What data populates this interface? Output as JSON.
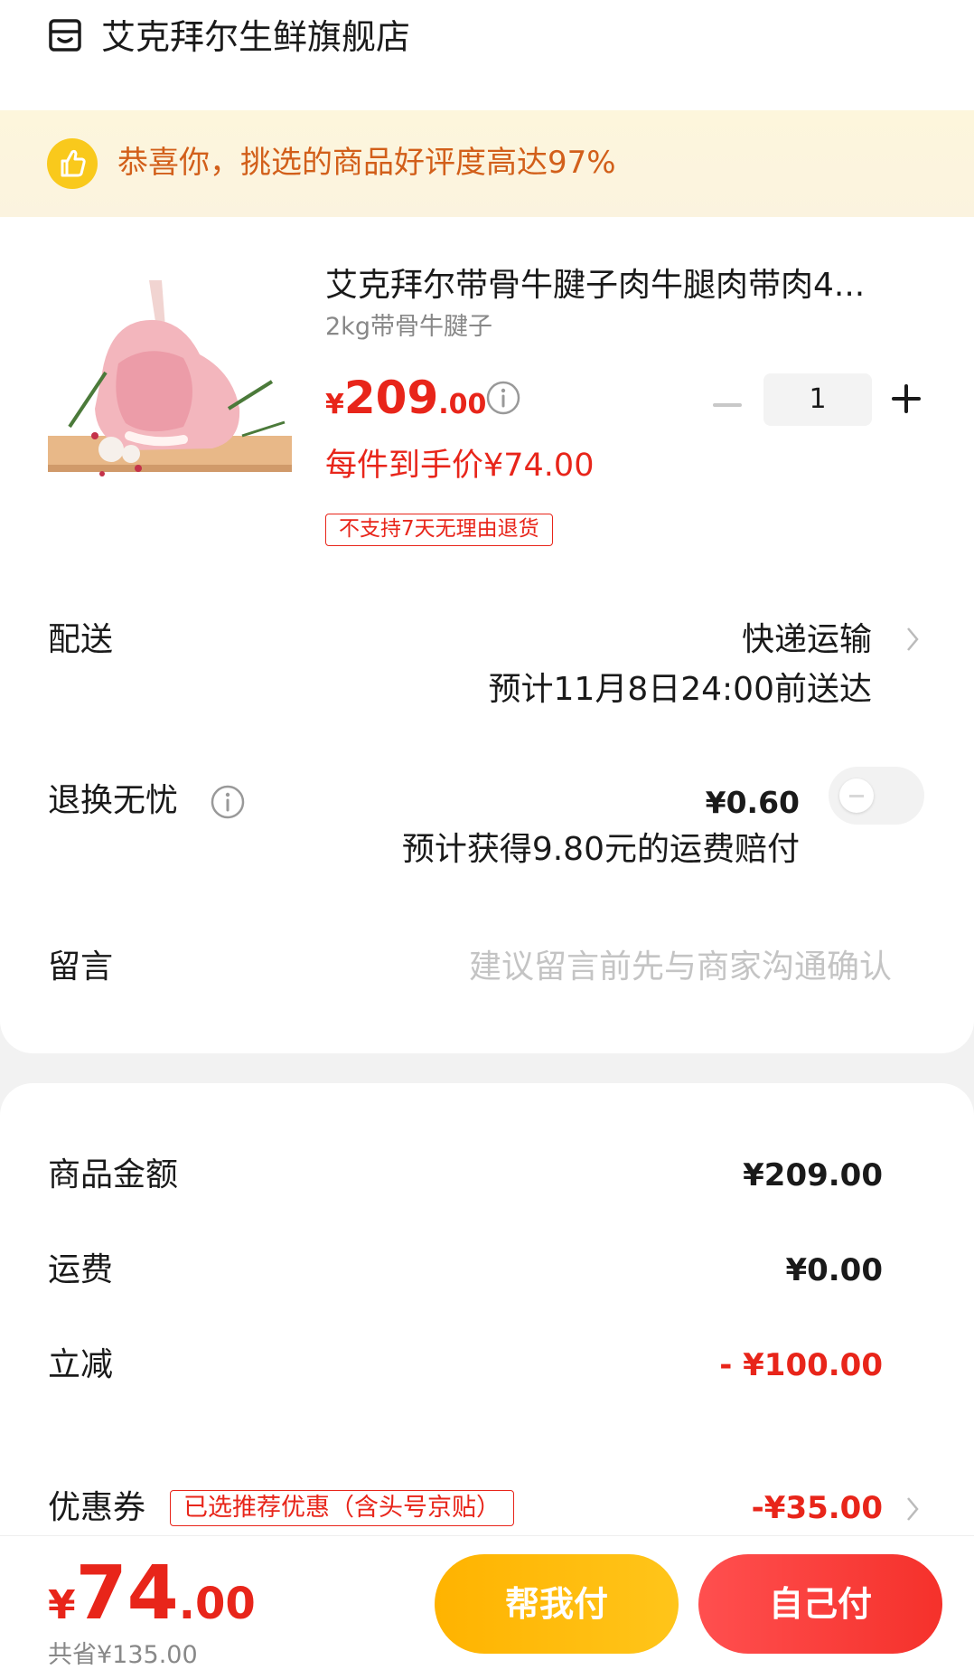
{
  "store": {
    "name": "艾克拜尔生鲜旗舰店",
    "icon": "store-icon"
  },
  "banner": {
    "text": "恭喜你，挑选的商品好评度高达97%",
    "icon": "thumbs-up-icon"
  },
  "product": {
    "title": "艾克拜尔带骨牛腱子肉牛腿肉带肉4...",
    "spec": "2kg带骨牛腱子",
    "price_symbol": "¥",
    "price_int": "209",
    "price_dec": ".00",
    "quantity": "1",
    "hand_price": "每件到手价¥74.00",
    "return_tag": "不支持7天无理由退货"
  },
  "delivery": {
    "label": "配送",
    "method": "快递运输",
    "eta": "预计11月8日24:00前送达"
  },
  "return_insurance": {
    "label": "退换无忧",
    "price": "¥0.60",
    "note": "预计获得9.80元的运费赔付",
    "enabled": false
  },
  "message": {
    "label": "留言",
    "placeholder": "建议留言前先与商家沟通确认"
  },
  "summary": {
    "goods_label": "商品金额",
    "goods_value": "¥209.00",
    "shipping_label": "运费",
    "shipping_value": "¥0.00",
    "discount_label": "立减",
    "discount_value": "- ¥100.00",
    "coupon_label": "优惠券",
    "coupon_tag": "已选推荐优惠（含头号京贴）",
    "coupon_value": "-¥35.00"
  },
  "checkout": {
    "total_symbol": "¥",
    "total_int": "74",
    "total_dec": ".00",
    "saved": "共省¥135.00",
    "help_pay": "帮我付",
    "self_pay": "自己付"
  },
  "colors": {
    "accent_red": "#e8251a",
    "banner_text": "#d25f1a",
    "help_button": "#ffb300",
    "pay_button": "#f5312b"
  }
}
